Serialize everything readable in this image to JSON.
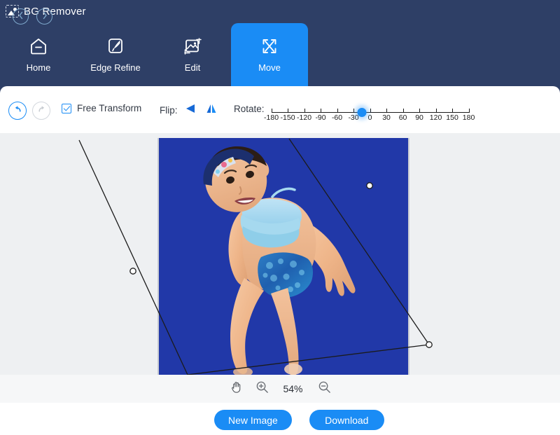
{
  "app": {
    "title": "BG Remover",
    "logo_icon": "image-placeholder-icon"
  },
  "tabs": [
    {
      "id": "home",
      "label": "Home",
      "icon": "home-icon",
      "active": false
    },
    {
      "id": "edge-refine",
      "label": "Edge Refine",
      "icon": "brush-edit-icon",
      "active": false
    },
    {
      "id": "edit",
      "label": "Edit",
      "icon": "image-edit-icon",
      "active": false
    },
    {
      "id": "move",
      "label": "Move",
      "icon": "move-arrows-icon",
      "active": true
    }
  ],
  "toolbar": {
    "undo_icon": "undo-arrow-icon",
    "redo_icon": "redo-arrow-icon",
    "undo_enabled": true,
    "redo_enabled": false,
    "free_transform_label": "Free Transform",
    "free_transform_checked": true,
    "flip_label": "Flip:",
    "flip_horizontal_icon": "flip-horizontal-icon",
    "flip_vertical_icon": "flip-vertical-icon",
    "rotate_label": "Rotate:",
    "rotate": {
      "min": -180,
      "max": 180,
      "value": -15,
      "ticks": [
        -180,
        -150,
        -120,
        -90,
        -60,
        -30,
        0,
        30,
        60,
        90,
        120,
        150,
        180
      ],
      "tick_labels": [
        "-180",
        "-150",
        "-120",
        "-90",
        "-60",
        "-30",
        "0",
        "30",
        "60",
        "90",
        "120",
        "150",
        "180"
      ]
    }
  },
  "canvas": {
    "background_color": "#eef0f2",
    "image_background_color": "#2138a8",
    "transform_frame": {
      "visible": true,
      "handles": [
        "left-mid-handle",
        "right-mid-handle",
        "bottom-right-corner-handle"
      ]
    }
  },
  "zoombar": {
    "hand_tool_icon": "hand-tool-icon",
    "zoom_in_icon": "zoom-in-icon",
    "zoom_out_icon": "zoom-out-icon",
    "zoom_level": "54%"
  },
  "footer": {
    "prev_icon": "chevron-left-icon",
    "next_icon": "chevron-right-icon",
    "new_image_label": "New Image",
    "download_label": "Download"
  },
  "colors": {
    "header_navy": "#2e3f66",
    "accent_blue": "#1a8cf5",
    "canvas_gray": "#eef0f2",
    "photo_blue": "#2138a8"
  }
}
